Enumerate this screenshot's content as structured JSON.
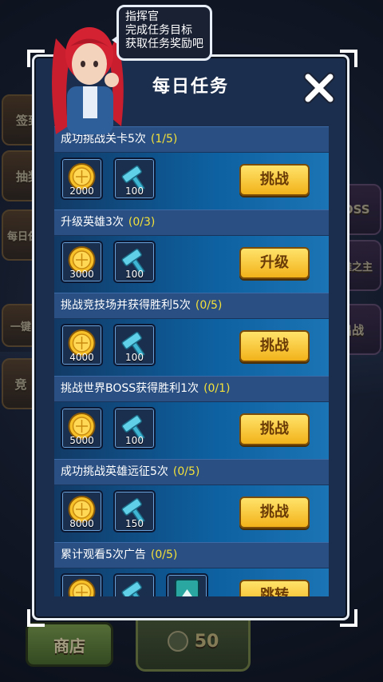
{
  "background": {
    "side_buttons": [
      "签到",
      "抽奖",
      "每日任务"
    ],
    "right_labels": [
      "BOSS",
      "英雄之主",
      "出战"
    ],
    "left_mid_labels": [
      "竞",
      "一键"
    ],
    "shop_label": "商店",
    "coin_count": "50"
  },
  "speech_bubble": {
    "lines": [
      "指挥官",
      "完成任务目标",
      "获取任务奖励吧"
    ]
  },
  "dialog": {
    "title": "每日任务",
    "close_label": "✕"
  },
  "tasks": [
    {
      "title": "成功挑战关卡5次",
      "progress": "(1/5)",
      "rewards": [
        {
          "icon": "gold-coin-icon",
          "qty": "2000"
        },
        {
          "icon": "hammer-icon",
          "qty": "100"
        }
      ],
      "action": "挑战"
    },
    {
      "title": "升级英雄3次",
      "progress": "(0/3)",
      "rewards": [
        {
          "icon": "gold-coin-icon",
          "qty": "3000"
        },
        {
          "icon": "hammer-icon",
          "qty": "100"
        }
      ],
      "action": "升级"
    },
    {
      "title": "挑战竞技场并获得胜利5次",
      "progress": "(0/5)",
      "rewards": [
        {
          "icon": "gold-coin-icon",
          "qty": "4000"
        },
        {
          "icon": "hammer-icon",
          "qty": "100"
        }
      ],
      "action": "挑战"
    },
    {
      "title": "挑战世界BOSS获得胜利1次",
      "progress": "(0/1)",
      "rewards": [
        {
          "icon": "gold-coin-icon",
          "qty": "5000"
        },
        {
          "icon": "hammer-icon",
          "qty": "100"
        }
      ],
      "action": "挑战"
    },
    {
      "title": "成功挑战英雄远征5次",
      "progress": "(0/5)",
      "rewards": [
        {
          "icon": "gold-coin-icon",
          "qty": "8000"
        },
        {
          "icon": "hammer-icon",
          "qty": "150"
        }
      ],
      "action": "挑战"
    },
    {
      "title": "累计观看5次广告",
      "progress": "(0/5)",
      "rewards": [
        {
          "icon": "gold-coin-icon",
          "qty": ""
        },
        {
          "icon": "hammer-icon",
          "qty": ""
        },
        {
          "icon": "card-icon",
          "qty": ""
        }
      ],
      "action": "跳转"
    }
  ],
  "colors": {
    "progress": "#f3e13a",
    "button_fill": "#f7c83a",
    "panel": "#1c2e4d"
  }
}
